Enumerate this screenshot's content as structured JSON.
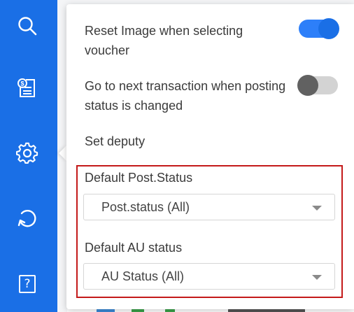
{
  "nav": {
    "items": [
      {
        "icon": "search-icon"
      },
      {
        "icon": "voucher-icon"
      },
      {
        "icon": "gear-icon"
      },
      {
        "icon": "refresh-icon"
      },
      {
        "icon": "help-icon",
        "glyph": "?"
      }
    ]
  },
  "settings": {
    "reset_image": {
      "label": "Reset Image when selecting voucher",
      "enabled": true
    },
    "next_transaction": {
      "label": "Go to next transaction when posting status is changed",
      "enabled": false
    },
    "set_deputy": {
      "label": "Set deputy"
    },
    "default_post_status": {
      "label": "Default Post.Status",
      "value": "Post.status (All)"
    },
    "default_au_status": {
      "label": "Default AU status",
      "value": "AU Status (All)"
    }
  },
  "colors": {
    "rail": "#1a6fe6",
    "toggle_on": "#2d7ff9",
    "highlight_border": "#c41a1a"
  }
}
